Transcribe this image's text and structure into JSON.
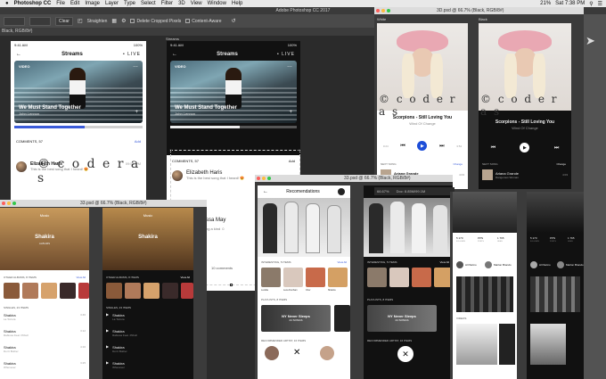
{
  "menubar": {
    "apple": "",
    "app": "Photoshop CC",
    "items": [
      "File",
      "Edit",
      "Image",
      "Layer",
      "Type",
      "Select",
      "Filter",
      "3D",
      "View",
      "Window",
      "Help"
    ],
    "right": [
      "21%",
      "Sat 7:38 PM"
    ]
  },
  "ps": {
    "title": "Adobe Photoshop CC 2017",
    "options": {
      "clear": "Clear",
      "straighten": "Straighten",
      "delete_cropped": "Delete Cropped Pixels",
      "content_aware": "Content-Aware"
    },
    "doc_tab": "Black, RGB/8#)"
  },
  "screen_white": {
    "time": "9:41 AM",
    "battery": "100%",
    "title": "Streams",
    "live": "• LIVE",
    "video_tag": "VIDEO",
    "video_title": "We Must Stand Together",
    "video_sub": "John Lennon",
    "comments_label": "COMMENTS, 57",
    "add": "Add",
    "commenter": "Elizabeth Haris",
    "comment": "This is the best song that I heard! 😍",
    "ctime": "09:56 PM"
  },
  "screen_black": {
    "label": "Streams",
    "time": "9:41 AM",
    "battery": "100%",
    "title": "Streams",
    "live": "• LIVE",
    "video_tag": "VIDEO",
    "video_title": "We Must Stand Together",
    "video_sub": "John Lennon",
    "comments_label": "COMMENTS, 57",
    "add": "Add",
    "commenter": "Elizabeth Haris",
    "comment": "This is the best song that I heard! 😍",
    "partial_name": "ssa May",
    "partial_text": "ng a kind ☺",
    "comments_btn": "10 comments"
  },
  "watermark": "© c o d e r a s",
  "player_window": {
    "title": "3D.psd @ 66.7% (Black, RGB/8#)",
    "white_label": "White",
    "black_label": "Black",
    "time": "9:41 AM",
    "song": "Scorpions - Still Loving You",
    "album": "Wind Of Change",
    "t_start": "0:24",
    "t_end": "3:54",
    "next": "NEXT SONG",
    "change": "Change",
    "next_title": "Ariana Grande",
    "next_sub": "Dangerous Woman",
    "next_time": "4:03"
  },
  "music_window": {
    "title": "33.psd @ 66.7% (Black, RGB/8#)",
    "hero_label": "Music",
    "artist": "Shakira",
    "artist_sub": "ALBUMS",
    "others": "OTHER ALBUMS, 8 ITEMS",
    "view_all": "View All",
    "singles": "SINGLES, 23 ITEMS",
    "tracks": [
      {
        "t": "Shakira",
        "s": "La Tortura",
        "d": "3:46"
      },
      {
        "t": "Shakira",
        "s": "Rabiosa Feat. Pitbull",
        "d": "3:12"
      },
      {
        "t": "Shakira",
        "s": "Don't Bother",
        "d": "4:16"
      },
      {
        "t": "Shakira",
        "s": "Whenever",
        "d": "3:25"
      }
    ]
  },
  "rec_window": {
    "title": "33.psd @ 66.7% (Black, RGB/8#)",
    "header": "Recomendations",
    "interesting": "INTERESTING, 5 ITEMS",
    "view_all": "View All",
    "names": [
      "Lucidia",
      "Lena Dunham",
      "Cher",
      "Shakira"
    ],
    "playlists": "PLAYLISTS, 8 ITEMS",
    "banner": "NY Never Sleeps",
    "banner_sub": "24 SONGS",
    "artists": "RECOMMENDED ARTIST, 16 ITEMS"
  },
  "dark_window": {
    "zoom": "66.67%",
    "doc": "Doc: 8.85M/99.1M"
  },
  "profile_window": {
    "name": "Al Pacino",
    "name2": "Marlon Brando",
    "stats": [
      {
        "v": "5 170",
        "l": "FOLLOWS"
      },
      {
        "v": "PPN",
        "l": "POSTS"
      },
      {
        "v": "1 765",
        "l": "LIKES"
      }
    ],
    "video_label": "VIDEOS"
  }
}
